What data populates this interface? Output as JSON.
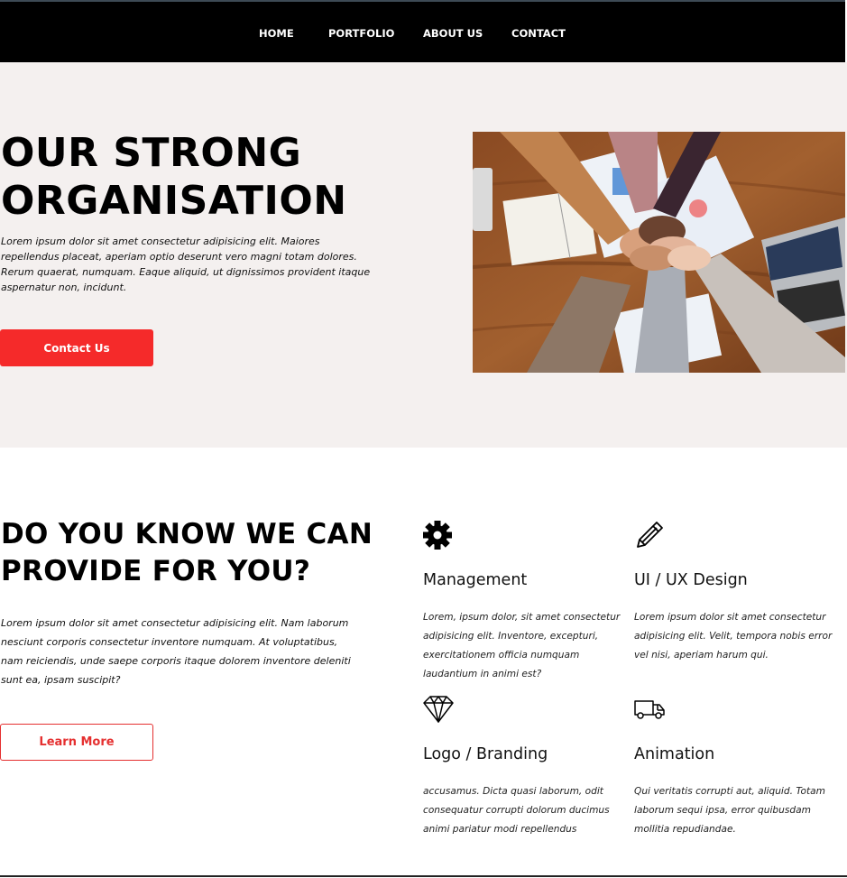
{
  "nav": {
    "items": [
      {
        "label": "HOME"
      },
      {
        "label": "PORTFOLIO"
      },
      {
        "label": "ABOUT US"
      },
      {
        "label": "CONTACT"
      }
    ]
  },
  "hero": {
    "title_line1": "OUR STRONG",
    "title_line2": "ORGANISATION",
    "text": "Lorem ipsum dolor sit amet consectetur adipisicing elit. Maiores repellendus placeat, aperiam optio deserunt vero magni totam dolores. Rerum quaerat, numquam. Eaque aliquid, ut dignissimos provident itaque aspernatur non, incidunt.",
    "button_label": "Contact Us"
  },
  "services": {
    "title_line1": "DO YOU KNOW WE CAN",
    "title_line2": "PROVIDE FOR YOU?",
    "text": "Lorem ipsum dolor sit amet consectetur adipisicing elit. Nam laborum nesciunt corporis consectetur inventore numquam. At voluptatibus, nam reiciendis, unde saepe corporis itaque dolorem inventore deleniti sunt ea, ipsam suscipit?",
    "button_label": "Learn More",
    "features": [
      {
        "icon": "gear-icon",
        "title": "Management",
        "text": "Lorem, ipsum dolor, sit amet consectetur adipisicing elit. Inventore, excepturi, exercitationem officia numquam laudantium in animi est?"
      },
      {
        "icon": "pencil-icon",
        "title": "UI / UX Design",
        "text": "Lorem ipsum dolor sit amet consectetur adipisicing elit. Velit, tempora nobis error vel nisi, aperiam harum qui."
      },
      {
        "icon": "diamond-icon",
        "title": "Logo / Branding",
        "text": "accusamus. Dicta quasi laborum, odit consequatur corrupti dolorum ducimus animi pariatur modi repellendus"
      },
      {
        "icon": "truck-icon",
        "title": "Animation",
        "text": "Qui veritatis corrupti aut, aliquid. Totam laborum sequi ipsa, error quibusdam mollitia repudiandae."
      }
    ]
  },
  "colors": {
    "nav_bg": "#000000",
    "hero_bg": "#f4f0ef",
    "accent_red": "#f52a2a"
  }
}
